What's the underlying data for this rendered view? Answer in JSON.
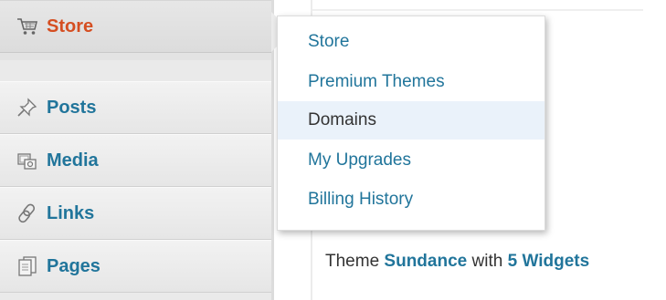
{
  "sidebar": {
    "items": [
      {
        "label": "Store",
        "icon": "cart-icon",
        "active": true
      },
      {
        "label": "Posts",
        "icon": "pushpin-icon"
      },
      {
        "label": "Media",
        "icon": "media-icon"
      },
      {
        "label": "Links",
        "icon": "chain-link-icon"
      },
      {
        "label": "Pages",
        "icon": "pages-icon"
      }
    ]
  },
  "flyout": {
    "items": [
      {
        "label": "Store"
      },
      {
        "label": "Premium Themes"
      },
      {
        "label": "Domains",
        "hovered": true
      },
      {
        "label": "My Upgrades"
      },
      {
        "label": "Billing History"
      }
    ]
  },
  "theme_info": {
    "prefix": "Theme",
    "theme_name": "Sundance",
    "middle": "with",
    "widgets": "5 Widgets"
  },
  "colors": {
    "link": "#21759b",
    "active": "#d54e21",
    "hover_bg": "#eaf2fa",
    "text": "#333333"
  }
}
